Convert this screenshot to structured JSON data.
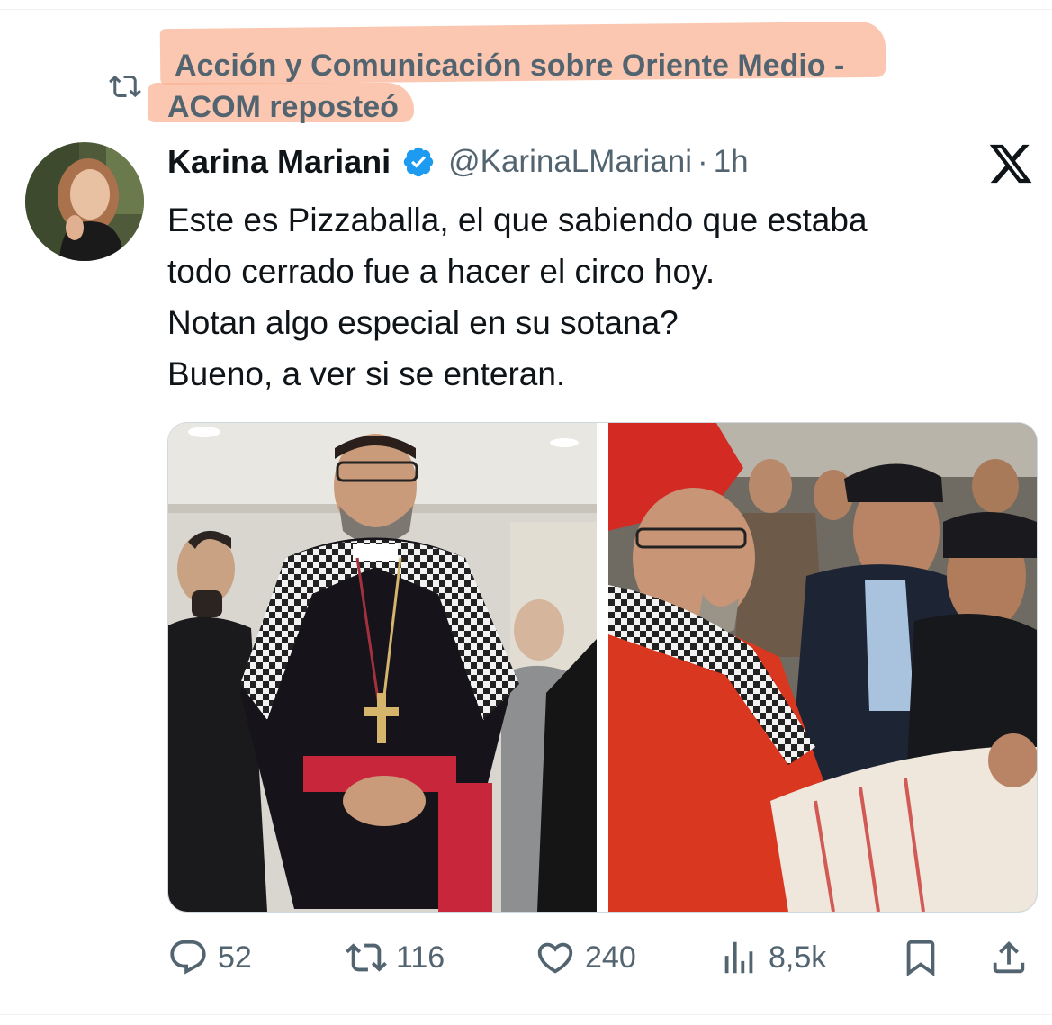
{
  "repost": {
    "icon": "repost-icon",
    "text_line1": "Acción y Comunicación sobre Oriente Medio -",
    "text_line2": "ACOM reposteó"
  },
  "author": {
    "name": "Karina Mariani",
    "handle": "@KarinaLMariani",
    "separator": "·",
    "time": "1h",
    "verified_icon": "verified-badge-icon"
  },
  "tweet": {
    "lines": [
      "Este es Pizzaballa, el que sabiendo que estaba",
      "todo cerrado fue a hacer el circo hoy.",
      "Notan algo especial en su sotana?",
      "Bueno, a ver si se enteran."
    ]
  },
  "actions": {
    "replies": "52",
    "reposts": "116",
    "likes": "240",
    "views": "8,5k"
  },
  "colors": {
    "secondary_text": "#536471",
    "highlight": "#f8b496",
    "verified": "#1d9bf0"
  }
}
